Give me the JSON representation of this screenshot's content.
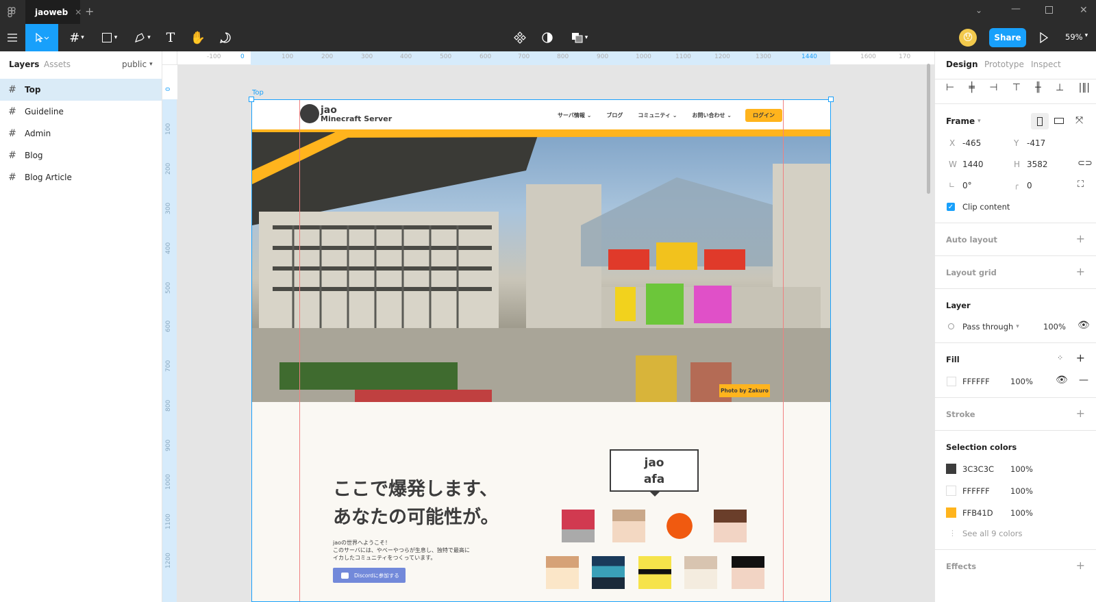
{
  "titlebar": {
    "tab_name": "jaoweb",
    "add_tab": "+"
  },
  "toolbar": {
    "zoom": "59%",
    "share_label": "Share"
  },
  "left": {
    "tabs": [
      "Layers",
      "Assets"
    ],
    "page_select": "public",
    "layers": [
      "Top",
      "Guideline",
      "Admin",
      "Blog",
      "Blog Article"
    ]
  },
  "ruler": {
    "top_ticks": [
      "-100",
      "0",
      "100",
      "200",
      "300",
      "400",
      "500",
      "600",
      "700",
      "800",
      "900",
      "1000",
      "1100",
      "1200",
      "1300",
      "1440",
      "1600",
      "170"
    ],
    "left_ticks": [
      "0",
      "100",
      "200",
      "300",
      "400",
      "500",
      "600",
      "700",
      "800",
      "900",
      "1000",
      "1100",
      "1200"
    ]
  },
  "frame": {
    "label": "Top",
    "nav_items": [
      "サーバ情報",
      "ブログ",
      "コミュニティ",
      "お問い合わせ"
    ],
    "login": "ログイン",
    "logo_line1": "jao",
    "logo_line2": "Minecraft Server",
    "photo_credit": "Photo by Zakuro",
    "headline1": "ここで爆発します、",
    "headline2": "あなたの可能性が。",
    "body1": "jaoの世界へようこそ！",
    "body2": "このサーバには、やべーやつらが生息し、独特で最高に",
    "body3": "イカしたコミュニティをつくっています。",
    "discord_btn": "Discordに参加する",
    "bubble1": "jao",
    "bubble2": "afa"
  },
  "right": {
    "tabs": [
      "Design",
      "Prototype",
      "Inspect"
    ],
    "frame_label": "Frame",
    "x_label": "X",
    "x": "-465",
    "y_label": "Y",
    "y": "-417",
    "w_label": "W",
    "w": "1440",
    "h_label": "H",
    "h": "3582",
    "rotation": "0°",
    "radius": "0",
    "clip_content": "Clip content",
    "auto_layout": "Auto layout",
    "layout_grid": "Layout grid",
    "layer_title": "Layer",
    "blend": "Pass through",
    "opacity": "100%",
    "fill_title": "Fill",
    "fill_hex": "FFFFFF",
    "fill_opacity": "100%",
    "stroke": "Stroke",
    "selection_colors": "Selection colors",
    "colors": [
      {
        "hex": "3C3C3C",
        "opacity": "100%",
        "swatch": "#3C3C3C"
      },
      {
        "hex": "FFFFFF",
        "opacity": "100%",
        "swatch": "#FFFFFF"
      },
      {
        "hex": "FFB41D",
        "opacity": "100%",
        "swatch": "#FFB41D"
      }
    ],
    "see_all": "See all 9 colors",
    "effects": "Effects"
  },
  "colors": {
    "accent": "#18a0fb",
    "brand_yellow": "#FFB41D",
    "discord": "#7289da"
  }
}
